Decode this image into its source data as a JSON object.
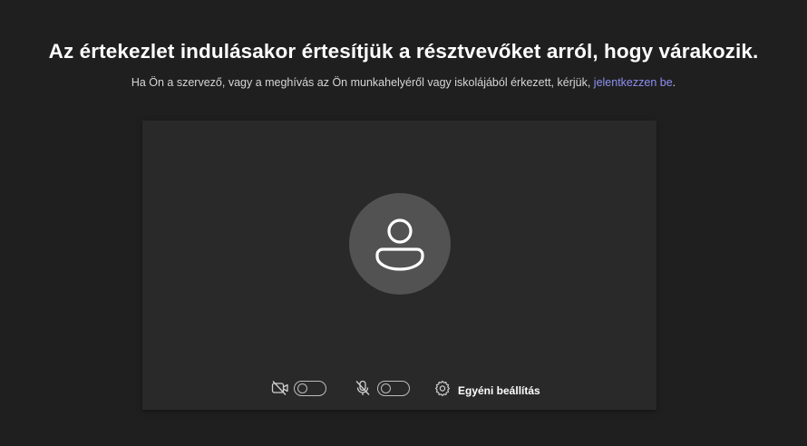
{
  "header": {
    "title": "Az értekezlet indulásakor értesítjük a résztvevőket arról, hogy várakozik.",
    "subtitle_prefix": "Ha Ön a szervező, vagy a meghívás az Ön munkahelyéről vagy iskolájából érkezett, kérjük, ",
    "signin_link": "jelentkezzen be",
    "subtitle_suffix": "."
  },
  "preview": {
    "avatar_icon": "person-icon",
    "camera": {
      "icon": "camera-off-icon",
      "enabled": false
    },
    "microphone": {
      "icon": "mic-off-icon",
      "enabled": false
    },
    "settings": {
      "icon": "gear-icon",
      "label": "Egyéni beállítás"
    }
  },
  "colors": {
    "background": "#1f1f1f",
    "preview_bg": "#292929",
    "avatar_bg": "#525252",
    "link": "#8e90f2"
  }
}
